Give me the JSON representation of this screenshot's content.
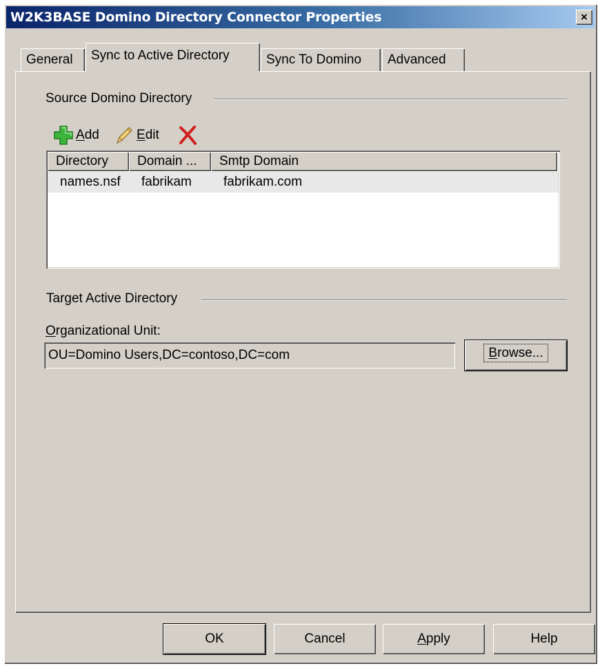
{
  "window": {
    "title": "W2K3BASE Domino Directory Connector Properties",
    "close_glyph": "×"
  },
  "tabs": [
    {
      "label": "General"
    },
    {
      "label": "Sync to Active Directory",
      "active": true
    },
    {
      "label": "Sync To Domino"
    },
    {
      "label": "Advanced"
    }
  ],
  "source_group": {
    "label": "Source Domino Directory",
    "toolbar": {
      "add": {
        "mnemonic": "A",
        "rest": "dd",
        "icon": "add-plus-icon",
        "color": "#2fa82f"
      },
      "edit": {
        "mnemonic": "E",
        "rest": "dit",
        "icon": "pencil-icon"
      },
      "delete": {
        "icon": "delete-x-icon",
        "color": "#d21f1f"
      }
    },
    "list": {
      "columns": [
        "Directory",
        "Domain ...",
        "Smtp Domain"
      ],
      "rows": [
        [
          "names.nsf",
          "fabrikam",
          "fabrikam.com"
        ]
      ]
    }
  },
  "target_group": {
    "label": "Target Active Directory",
    "ou_label_mnemonic": "O",
    "ou_label_rest": "rganizational Unit:",
    "ou_value": "OU=Domino Users,DC=contoso,DC=com",
    "browse": {
      "mnemonic": "B",
      "rest": "rowse..."
    }
  },
  "buttons": {
    "ok": "OK",
    "cancel": "Cancel",
    "apply_mnemonic": "A",
    "apply_rest": "pply",
    "help": "Help"
  }
}
